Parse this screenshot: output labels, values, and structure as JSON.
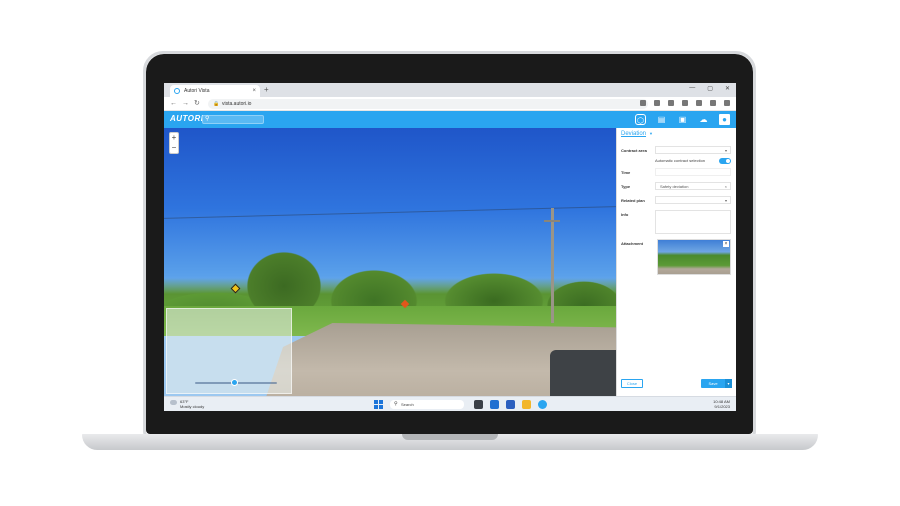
{
  "browser": {
    "tab_title": "Autori Vista",
    "tab_close": "×",
    "new_tab": "+",
    "window_controls": [
      "—",
      "▢",
      "✕"
    ],
    "url": "vista.autori.io",
    "nav": {
      "back": "←",
      "forward": "→",
      "reload": "↻"
    }
  },
  "app": {
    "logo": "AUTORI",
    "search_placeholder": "",
    "header_icons": [
      "hexagon-icon",
      "clipboard-icon",
      "briefcase-icon",
      "cloud-upload-icon",
      "user-avatar-icon"
    ]
  },
  "map": {
    "zoom_in": "+",
    "zoom_out": "−"
  },
  "panel": {
    "title": "Deviation",
    "title_caret": "▼",
    "contract_area_label": "Contract area",
    "contract_area_value": "",
    "auto_contract_label": "Automatic contract selection",
    "auto_contract_on": true,
    "time_label": "Time",
    "time_value": "",
    "type_label": "Type",
    "type_value": "Safety deviation",
    "type_clear": "×",
    "related_plan_label": "Related plan",
    "related_plan_value": "",
    "related_plan_dd": "▾",
    "info_label": "Info",
    "attachment_label": "Attachment",
    "attachment_remove": "×",
    "cancel": "Close",
    "save": "Save",
    "save_dd": "▾"
  },
  "taskbar": {
    "temperature": "63°F",
    "weather": "Mostly cloudy",
    "search": "Search",
    "time": "10:48 AM",
    "date": "9/1/2023"
  },
  "colors": {
    "accent": "#2aa5f0",
    "taskbar": "#e9eef4"
  }
}
